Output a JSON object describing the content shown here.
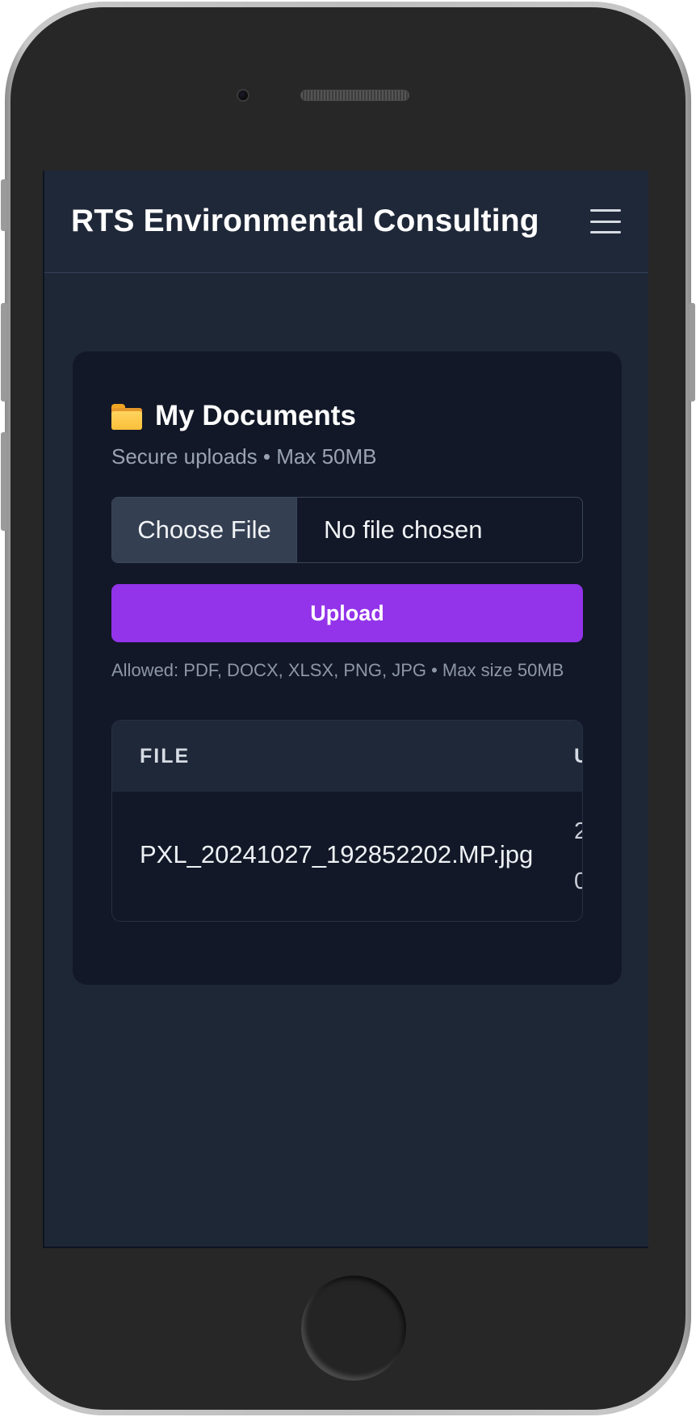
{
  "header": {
    "title": "RTS Environmental Consulting",
    "menu_icon": "hamburger-menu-icon"
  },
  "card": {
    "icon": "folder-icon",
    "title": "My Documents",
    "subtitle": "Secure uploads • Max 50MB"
  },
  "file_input": {
    "button_label": "Choose File",
    "status": "No file chosen"
  },
  "upload": {
    "label": "Upload",
    "color": "#9333ea"
  },
  "allowed_note": "Allowed: PDF, DOCX, XLSX, PNG, JPG • Max size 50MB",
  "table": {
    "columns": [
      "FILE",
      "U"
    ],
    "rows": [
      {
        "file": "PXL_20241027_192852202.MP.jpg",
        "uploaded_line1": "2",
        "uploaded_line2": "0"
      }
    ]
  },
  "colors": {
    "screen_bg": "#1e2736",
    "card_bg": "#121827",
    "accent": "#9333ea"
  }
}
